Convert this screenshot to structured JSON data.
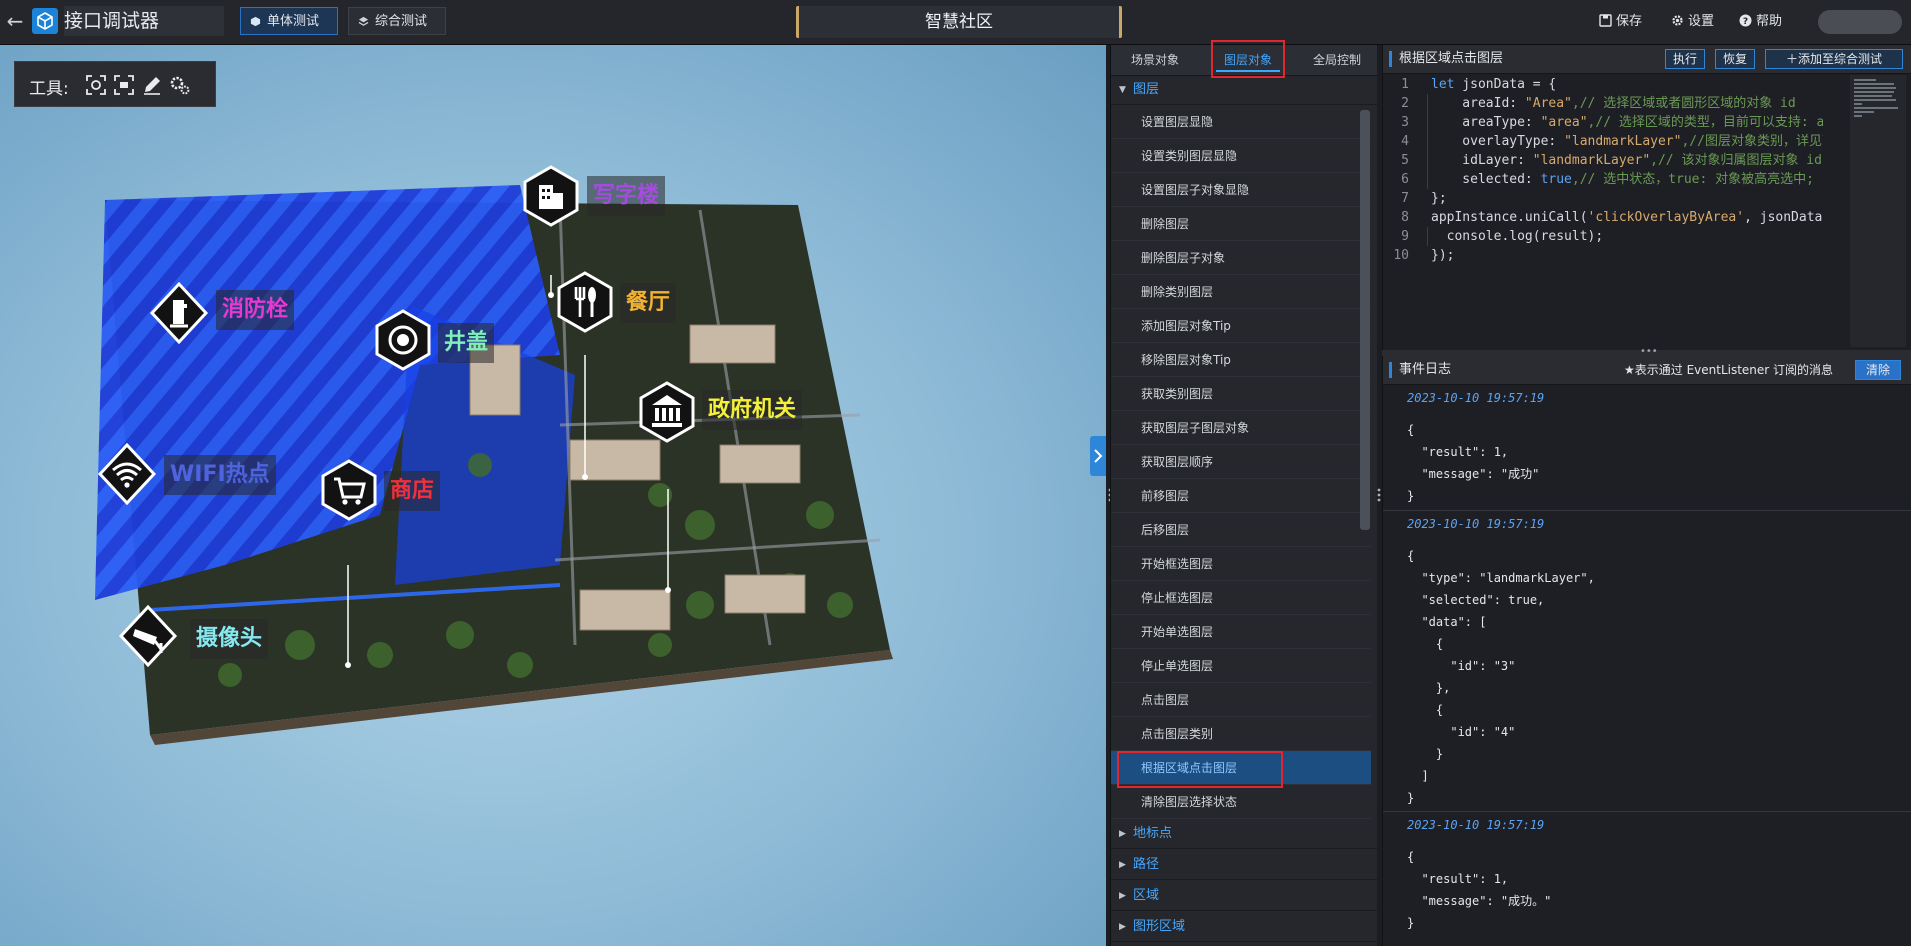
{
  "topbar": {
    "app_title": "接口调试器",
    "mode_single": "单体测试",
    "mode_combo": "综合测试",
    "center_title": "智慧社区",
    "save": "保存",
    "settings": "设置",
    "help": "帮助",
    "accent": "#2e86d8"
  },
  "map": {
    "toolbox_label": "工具:",
    "pois": [
      {
        "label": "写字楼",
        "color": "#a64be0",
        "icon": "office-building-icon"
      },
      {
        "label": "消防栓",
        "color": "#e43ad0",
        "icon": "fire-hydrant-icon"
      },
      {
        "label": "井盖",
        "color": "#7ef0b8",
        "icon": "manhole-cover-icon"
      },
      {
        "label": "餐厅",
        "color": "#f2b234",
        "icon": "restaurant-icon"
      },
      {
        "label": "政府机关",
        "color": "#f5f03a",
        "icon": "government-icon"
      },
      {
        "label": "WIFI热点",
        "color": "#4f63e0",
        "icon": "wifi-icon"
      },
      {
        "label": "商店",
        "color": "#f2303a",
        "icon": "shop-cart-icon"
      },
      {
        "label": "摄像头",
        "color": "#86e8f0",
        "icon": "camera-icon"
      }
    ]
  },
  "menu": {
    "tabs": [
      "场景对象",
      "图层对象",
      "全局控制"
    ],
    "active_tab": "图层对象",
    "open_group": "图层",
    "items": [
      "设置图层显隐",
      "设置类别图层显隐",
      "设置图层子对象显隐",
      "删除图层",
      "删除图层子对象",
      "删除类别图层",
      "添加图层对象Tip",
      "移除图层对象Tip",
      "获取类别图层",
      "获取图层子图层对象",
      "获取图层顺序",
      "前移图层",
      "后移图层",
      "开始框选图层",
      "停止框选图层",
      "开始单选图层",
      "停止单选图层",
      "点击图层",
      "点击图层类别",
      "根据区域点击图层",
      "清除图层选择状态"
    ],
    "active_item": "根据区域点击图层",
    "groups": [
      "地标点",
      "路径",
      "区域",
      "图形区域"
    ]
  },
  "code_panel": {
    "title": "根据区域点击图层",
    "run": "执行",
    "reset": "恢复",
    "add_combo": "添加至综合测试",
    "line_numbers": [
      "1",
      "2",
      "3",
      "4",
      "5",
      "6",
      "7",
      "8",
      "9",
      "10"
    ]
  },
  "log_panel": {
    "title": "事件日志",
    "note": "★表示通过 EventListener 订阅的消息",
    "clear": "清除",
    "entries": [
      {
        "time": "2023-10-10 19:57:19",
        "body": "{\n  \"result\": 1,\n  \"message\": \"成功\"\n}"
      },
      {
        "time": "2023-10-10 19:57:19",
        "body": "{\n  \"type\": \"landmarkLayer\",\n  \"selected\": true,\n  \"data\": [\n    {\n      \"id\": \"3\"\n    },\n    {\n      \"id\": \"4\"\n    }\n  ]\n}"
      },
      {
        "time": "2023-10-10 19:57:19",
        "body": "{\n  \"result\": 1,\n  \"message\": \"成功。\"\n}"
      }
    ]
  }
}
